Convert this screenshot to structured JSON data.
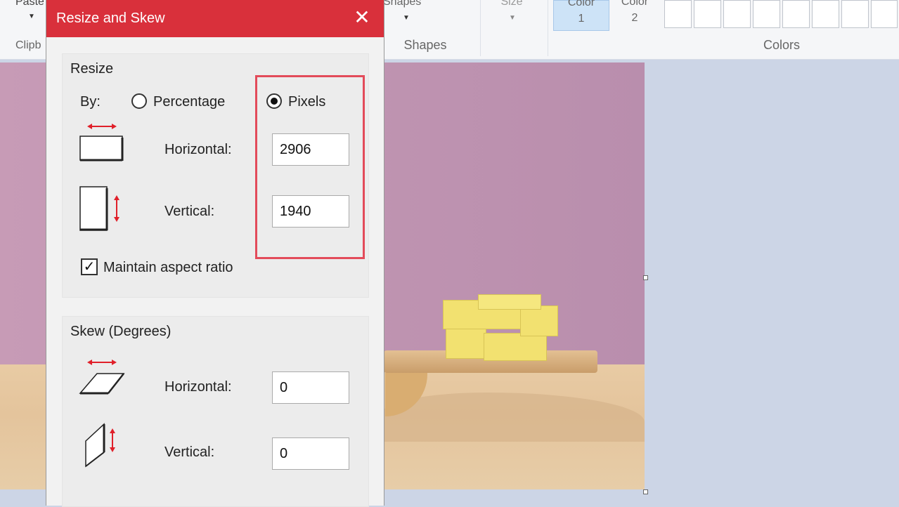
{
  "ribbon": {
    "paste_label": "Paste",
    "clipboard_group": "Clipb",
    "shapes_label": "Shapes",
    "shapes_group": "Shapes",
    "size_label": "Size",
    "color1_label_1": "Color",
    "color1_label_2": "1",
    "color2_label_1": "Color",
    "color2_label_2": "2",
    "colors_group": "Colors"
  },
  "dialog": {
    "title": "Resize and Skew",
    "resize": {
      "group_label": "Resize",
      "by_label": "By:",
      "option_percentage": "Percentage",
      "option_pixels": "Pixels",
      "selected": "Pixels",
      "horizontal_label": "Horizontal:",
      "horizontal_value": "2906",
      "vertical_label": "Vertical:",
      "vertical_value": "1940",
      "maintain_aspect_label": "Maintain aspect ratio",
      "maintain_aspect_checked": true
    },
    "skew": {
      "group_label": "Skew (Degrees)",
      "horizontal_label": "Horizontal:",
      "horizontal_value": "0",
      "vertical_label": "Vertical:",
      "vertical_value": "0"
    }
  },
  "colors": {
    "titlebar": "#d9303b",
    "highlight": "#e34b5a",
    "icon_accent": "#e0202a"
  },
  "icons": [
    "close-icon",
    "resize-horizontal-icon",
    "resize-vertical-icon",
    "skew-horizontal-icon",
    "skew-vertical-icon",
    "dropdown-arrow-icon"
  ]
}
